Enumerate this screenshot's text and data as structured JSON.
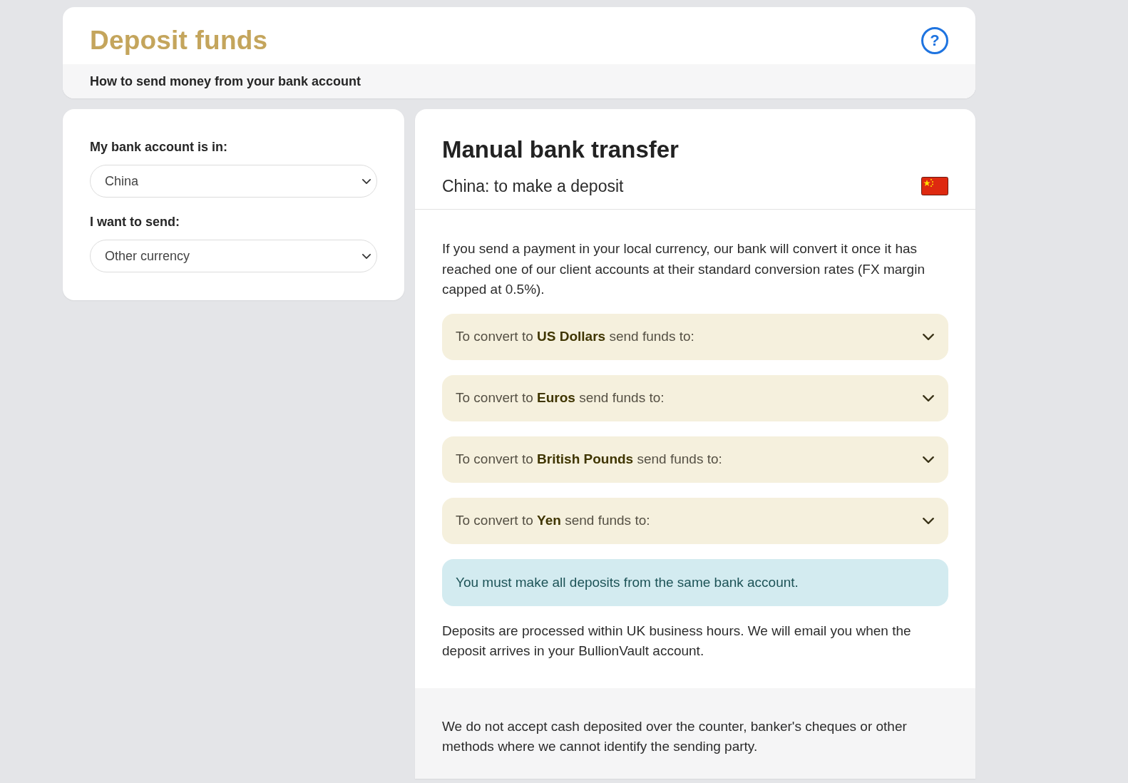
{
  "header": {
    "title": "Deposit funds",
    "help_button": "?",
    "subtitle": "How to send money from your bank account"
  },
  "filters": [
    {
      "label": "My bank account is in:",
      "value": "China"
    },
    {
      "label": "I want to send:",
      "value": "Other currency"
    }
  ],
  "transfer": {
    "title": "Manual bank transfer",
    "subtitle": "China: to make a deposit",
    "intro": "If you send a payment in your local currency, our bank will convert it once it has reached one of our client accounts at their standard conversion rates (FX margin capped at 0.5%).",
    "accordions": [
      {
        "label": "To convert to **US Dollars** send funds to:",
        "expanded": false
      },
      {
        "label": "To convert to **Euros** send funds to:",
        "expanded": false
      },
      {
        "label": "To convert to **British Pounds** send funds to:",
        "expanded": false
      },
      {
        "label": "To convert to **Yen** send funds to:",
        "expanded": false
      }
    ],
    "alert": "You must make all deposits from the same bank account.",
    "note": "Deposits are processed within UK business hours. We will email you when the deposit arrives in your BullionVault account.",
    "footer_note": "We do not accept cash deposited over the counter, banker's cheques or other methods where we cannot identify the sending party."
  }
}
